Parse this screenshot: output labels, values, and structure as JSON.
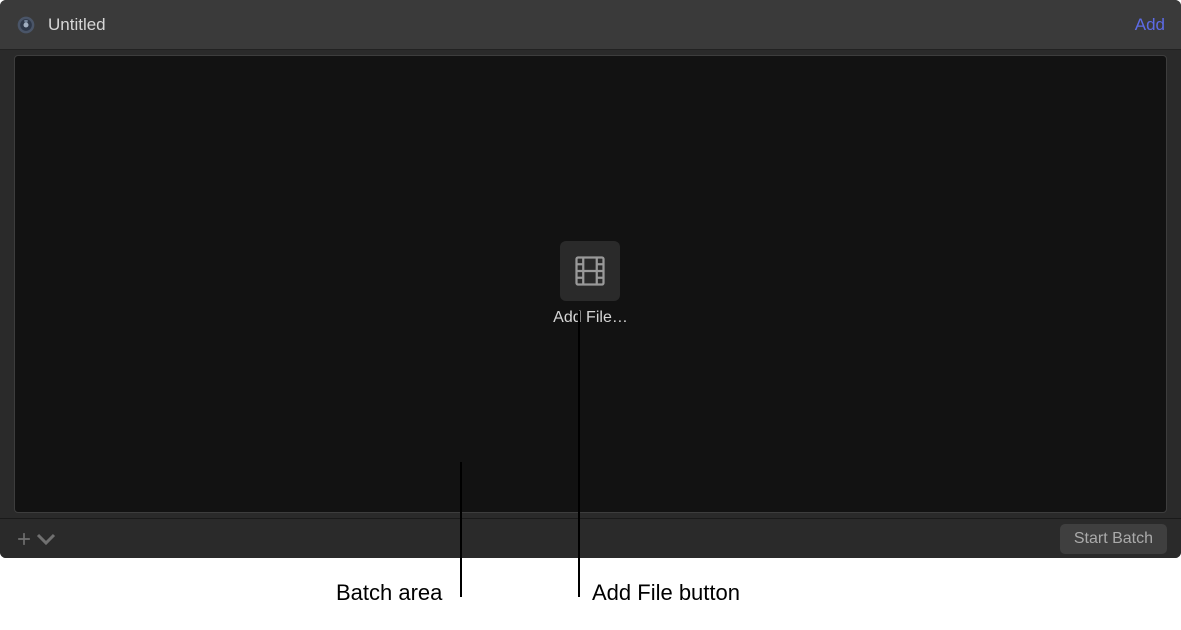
{
  "header": {
    "title": "Untitled",
    "add_label": "Add"
  },
  "batch": {
    "add_file_label": "Add File…"
  },
  "footer": {
    "start_batch_label": "Start Batch"
  },
  "annotations": {
    "batch_area": "Batch area",
    "add_file_button": "Add File button"
  }
}
